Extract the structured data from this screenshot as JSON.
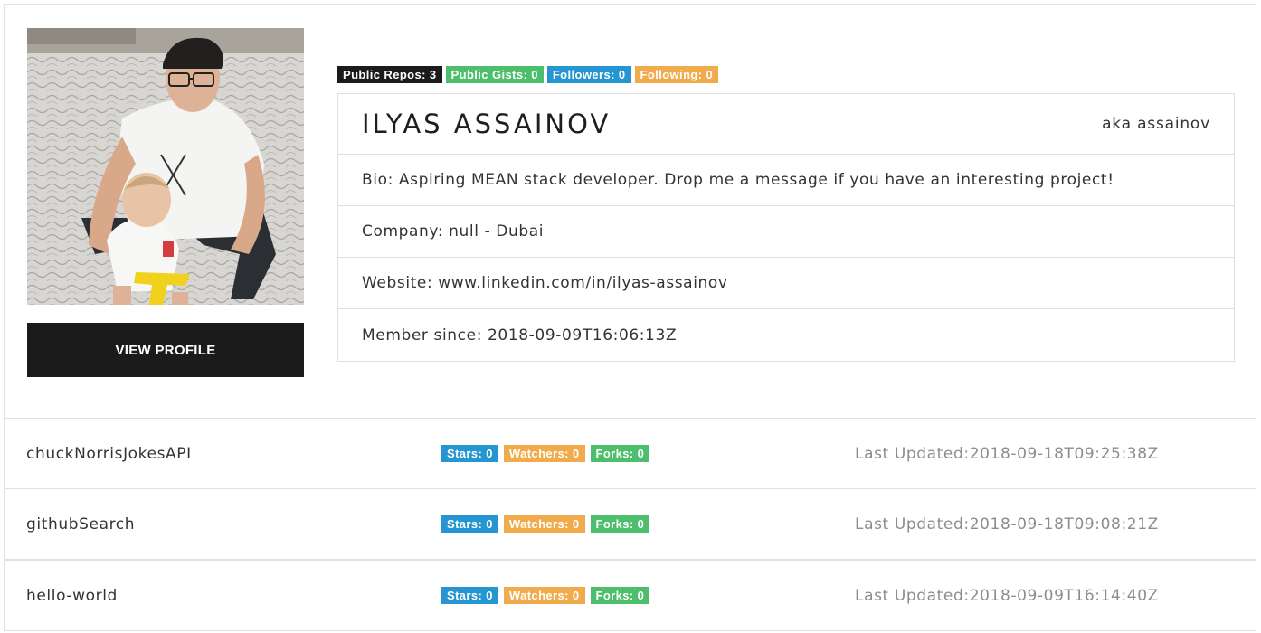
{
  "profile": {
    "view_profile_label": "VIEW PROFILE",
    "badges": {
      "public_repos": "Public Repos: 3",
      "public_gists": "Public Gists: 0",
      "followers": "Followers: 0",
      "following": "Following: 0"
    },
    "name": "ILYAS ASSAINOV",
    "alias": "aka assainov",
    "bio": "Bio: Aspiring MEAN stack developer. Drop me a message if you have an interesting project!",
    "company": "Company: null - Dubai",
    "website": "Website: www.linkedin.com/in/ilyas-assainov",
    "member_since": "Member since: 2018-09-09T16:06:13Z"
  },
  "repos": [
    {
      "name": "chuckNorrisJokesAPI",
      "stars": "Stars: 0",
      "watchers": "Watchers: 0",
      "forks": "Forks: 0",
      "updated": "Last Updated:2018-09-18T09:25:38Z"
    },
    {
      "name": "githubSearch",
      "stars": "Stars: 0",
      "watchers": "Watchers: 0",
      "forks": "Forks: 0",
      "updated": "Last Updated:2018-09-18T09:08:21Z"
    },
    {
      "name": "hello-world",
      "stars": "Stars: 0",
      "watchers": "Watchers: 0",
      "forks": "Forks: 0",
      "updated": "Last Updated:2018-09-09T16:14:40Z"
    }
  ],
  "colors": {
    "dark": "#1b1b1b",
    "green": "#4cbe6c",
    "blue": "#2596d1",
    "orange": "#f0ac4c"
  }
}
